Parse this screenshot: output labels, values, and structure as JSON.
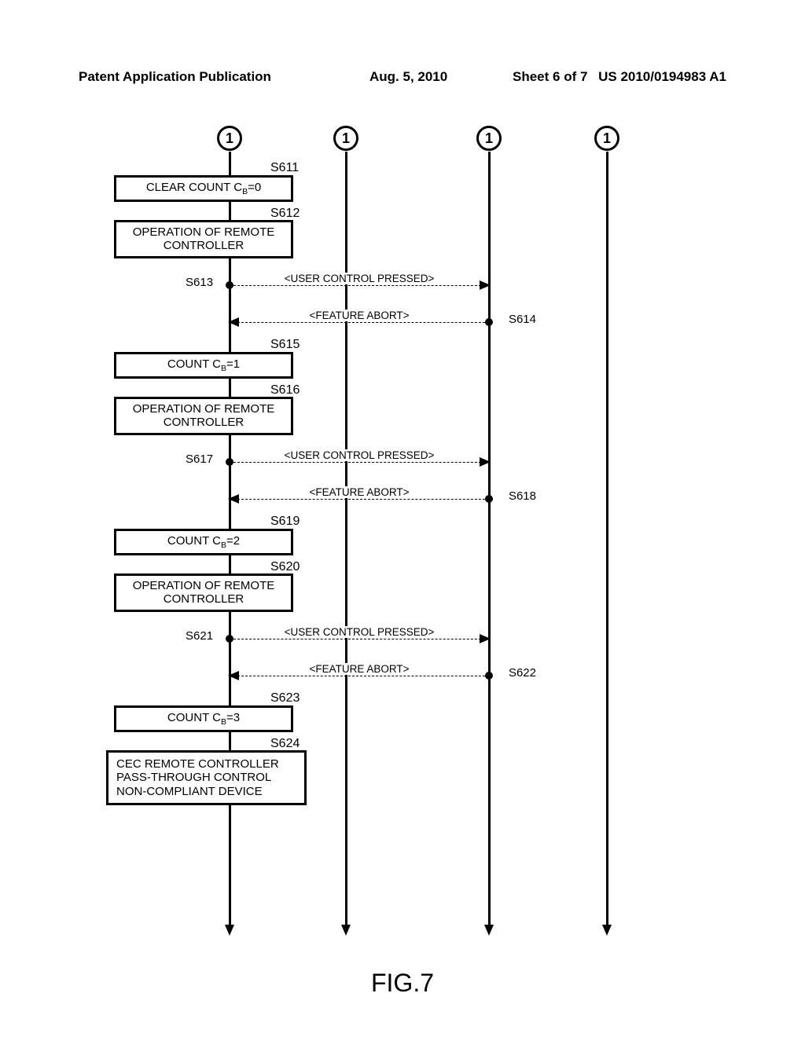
{
  "header": {
    "pubtitle": "Patent Application Publication",
    "pubdate": "Aug. 5, 2010",
    "sheet": "Sheet 6 of 7",
    "pubno": "US 2010/0194983 A1"
  },
  "lifelines": {
    "label1": "1",
    "label2": "1",
    "label3": "1",
    "label4": "1"
  },
  "steps": {
    "s611_label": "S611",
    "s611_text": "CLEAR COUNT C",
    "s611_text2": "=0",
    "s612_label": "S612",
    "s612_text": "OPERATION OF REMOTE CONTROLLER",
    "s613_label": "S613",
    "s613_msg": "<USER CONTROL PRESSED>",
    "s614_label": "S614",
    "s614_msg": "<FEATURE ABORT>",
    "s615_label": "S615",
    "s615_text": "COUNT C",
    "s615_text2": "=1",
    "s616_label": "S616",
    "s616_text": "OPERATION OF REMOTE CONTROLLER",
    "s617_label": "S617",
    "s617_msg": "<USER CONTROL PRESSED>",
    "s618_label": "S618",
    "s618_msg": "<FEATURE ABORT>",
    "s619_label": "S619",
    "s619_text": "COUNT C",
    "s619_text2": "=2",
    "s620_label": "S620",
    "s620_text": "OPERATION OF REMOTE CONTROLLER",
    "s621_label": "S621",
    "s621_msg": "<USER CONTROL PRESSED>",
    "s622_label": "S622",
    "s622_msg": "<FEATURE ABORT>",
    "s623_label": "S623",
    "s623_text": "COUNT C",
    "s623_text2": "=3",
    "s624_label": "S624",
    "s624_text": "CEC REMOTE CONTROLLER PASS-THROUGH CONTROL NON-COMPLIANT DEVICE",
    "subB": "B"
  },
  "fig": "FIG.7"
}
